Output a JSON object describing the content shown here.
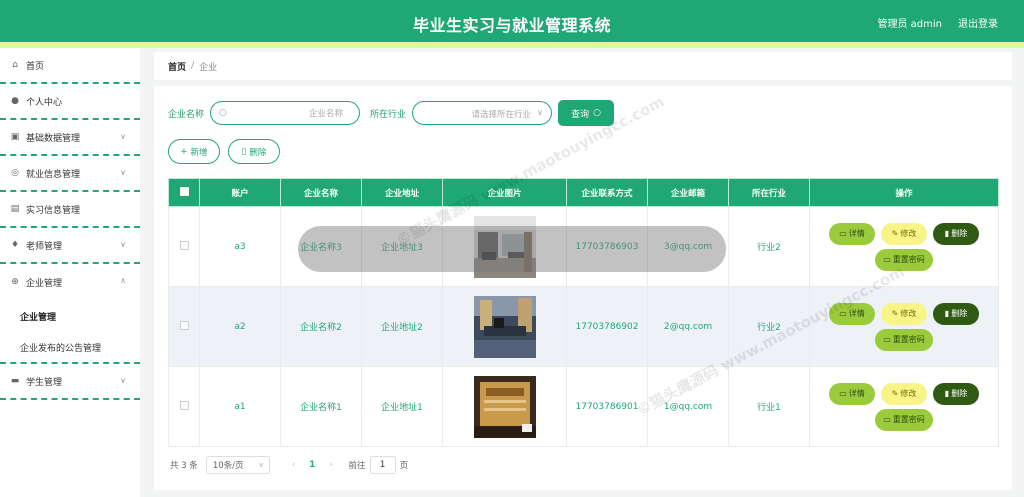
{
  "header": {
    "title": "毕业生实习与就业管理系统",
    "admin": "管理员 admin",
    "logout": "退出登录"
  },
  "sidebar": {
    "items": [
      {
        "label": "首页",
        "icon": "home-icon"
      },
      {
        "label": "个人中心",
        "icon": "user-icon"
      },
      {
        "label": "基础数据管理",
        "icon": "chart-icon"
      },
      {
        "label": "就业信息管理",
        "icon": "globe-icon"
      },
      {
        "label": "实习信息管理",
        "icon": "clipboard-icon"
      },
      {
        "label": "老师管理",
        "icon": "location-icon"
      },
      {
        "label": "企业管理",
        "icon": "compass-icon"
      },
      {
        "label": "学生管理",
        "icon": "printer-icon"
      }
    ],
    "sub_items": [
      {
        "label": "企业管理"
      },
      {
        "label": "企业发布的公告管理"
      }
    ]
  },
  "breadcrumb": {
    "home": "首页",
    "sep": "/",
    "current": "企业"
  },
  "search": {
    "name_label": "企业名称",
    "name_placeholder": "企业名称",
    "industry_label": "所在行业",
    "industry_placeholder": "请选择所在行业",
    "query_label": "查询"
  },
  "actions": {
    "add_label": "新增",
    "delete_label": "删除"
  },
  "table": {
    "headers": [
      "账户",
      "企业名称",
      "企业地址",
      "企业图片",
      "企业联系方式",
      "企业邮箱",
      "所在行业",
      "操作"
    ],
    "rows": [
      {
        "account": "a3",
        "name": "企业名称3",
        "address": "企业地址3",
        "phone": "17703786903",
        "email": "3@qq.com",
        "industry": "行业2"
      },
      {
        "account": "a2",
        "name": "企业名称2",
        "address": "企业地址2",
        "phone": "17703786902",
        "email": "2@qq.com",
        "industry": "行业2"
      },
      {
        "account": "a1",
        "name": "企业名称1",
        "address": "企业地址1",
        "phone": "17703786901",
        "email": "1@qq.com",
        "industry": "行业1"
      }
    ],
    "ops": {
      "detail": "详情",
      "edit": "修改",
      "delete": "删除",
      "reset": "重置密码"
    }
  },
  "pager": {
    "total": "共 3 条",
    "page_size": "10条/页",
    "current": "1",
    "goto_label": "前往",
    "goto_value": "1",
    "page_unit": "页"
  },
  "colors": {
    "primary": "#1fa776",
    "accent": "#e8f59a",
    "detail": "#9acb3c",
    "edit": "#f9f486",
    "danger": "#2f5a12"
  },
  "watermark": {
    "text": "©猫头鹰源码 www.maotouyingcc.com"
  }
}
